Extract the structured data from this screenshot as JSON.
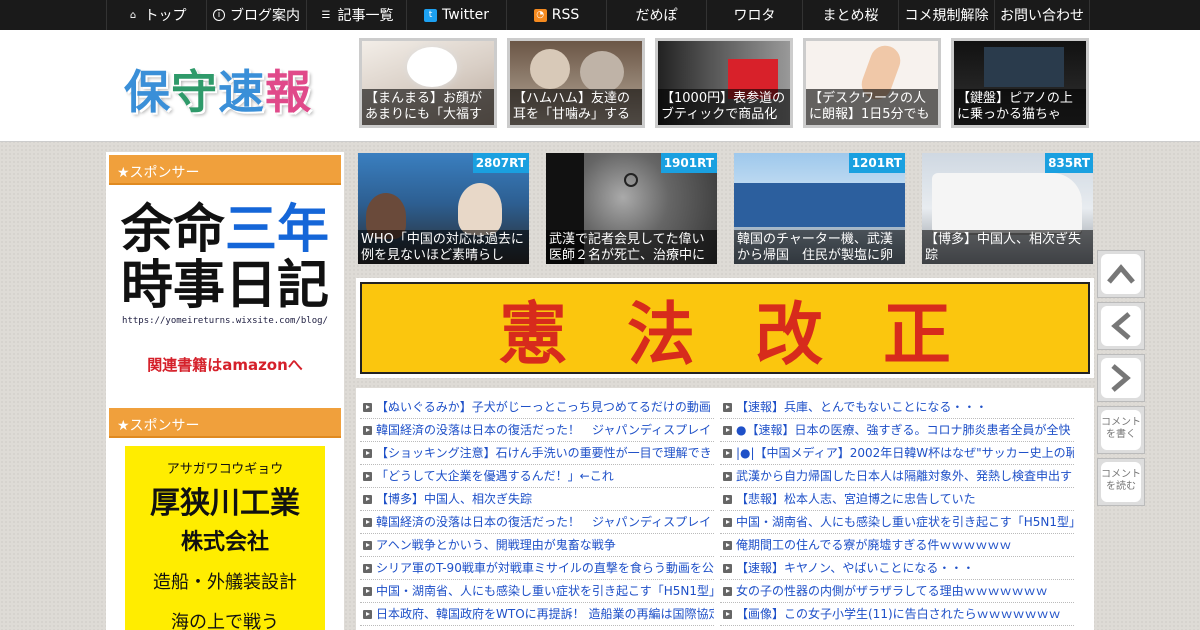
{
  "nav": [
    {
      "label": "トップ",
      "icon": "home-icon"
    },
    {
      "label": "ブログ案内",
      "icon": "info-icon"
    },
    {
      "label": "記事一覧",
      "icon": "list-icon"
    },
    {
      "label": "Twitter",
      "icon": "twitter-icon"
    },
    {
      "label": "RSS",
      "icon": "rss-icon"
    },
    {
      "label": "だめぽ"
    },
    {
      "label": "ワロタ"
    },
    {
      "label": "まとめ桜"
    },
    {
      "label": "コメ規制解除"
    },
    {
      "label": "お問い合わせ"
    }
  ],
  "logo": {
    "c1": "保",
    "c2": "守",
    "c3": "速",
    "c4": "報"
  },
  "header_thumbs": [
    {
      "caption": "【まんまる】お顔があまりにも「大福す"
    },
    {
      "caption": "【ハムハム】友達の耳を「甘噛み」する"
    },
    {
      "caption": "【1000円】表参道のブティックで商品化"
    },
    {
      "caption": "【デスクワークの人に朗報】1日5分でも"
    },
    {
      "caption": "【鍵盤】ピアノの上に乗っかる猫ちゃ"
    }
  ],
  "featured": [
    {
      "rt": "2807RT",
      "caption": "WHO「中国の対応は過去に例を見ないほど素晴らし"
    },
    {
      "rt": "1901RT",
      "caption": "武漢で記者会見してた偉い医師２名が死亡、治療中に"
    },
    {
      "rt": "1201RT",
      "caption": "韓国のチャーター機、武漢から帰国　住民が製塩に卵"
    },
    {
      "rt": "835RT",
      "caption": "【博多】中国人、相次ぎ失踪"
    }
  ],
  "sidebar": {
    "sponsor1": "★スポンサー",
    "ad1": {
      "line1a": "余命",
      "line1b": "三年",
      "line2": "時事日記",
      "url": "https://yomeireturns.wixsite.com/blog/",
      "link": "関連書籍はamazonへ"
    },
    "sponsor2": "★スポンサー",
    "ad2": {
      "kana": "アサガワコウギョウ",
      "name": "厚狭川工業",
      "corp": "株式会社",
      "desc": "造船・外艤装設計",
      "more": "海の上で戦う"
    }
  },
  "banner": {
    "c1": "憲",
    "c2": "法",
    "c3": "改",
    "c4": "正"
  },
  "list_left": [
    "【ぬいぐるみか】子犬がじーっとこっち見つめてるだけの動画",
    "韓国経済の没落は日本の復活だった！　ジャパンディスプレイ",
    "【ショッキング注意】石けん手洗いの重要性が一目で理解でき",
    "「どうして大企業を優遇するんだ！」←これ",
    "【博多】中国人、相次ぎ失踪",
    "韓国経済の没落は日本の復活だった！　ジャパンディスプレイ",
    "アヘン戦争とかいう、開戦理由が鬼畜な戦争",
    "シリア軍のT-90戦車が対戦車ミサイルの直撃を食らう動画を公",
    "中国・湖南省、人にも感染し重い症状を引き起こす「H5N1型」",
    "日本政府、韓国政府をWTOに再提訴！ 造船業の再編は国際協定"
  ],
  "list_right": [
    "【速報】兵庫、とんでもないことになる・・・",
    "●【速報】日本の医療、強すぎる。コロナ肺炎患者全員が全快",
    "|●|【中国メディア】2002年日韓W杯はなぜ\"サッカー史上の恥",
    "武漢から自力帰国した日本人は隔離対象外、発熱し検査申出す",
    "【悲報】松本人志、宮迫博之に忠告していた",
    "中国・湖南省、人にも感染し重い症状を引き起こす「H5N1型」",
    "俺期間工の住んでる寮が廃墟すぎる件ｗｗｗｗｗｗ",
    "【速報】キヤノン、やばいことになる・・・",
    "女の子の性器の内側がザラザラしてる理由ｗｗｗｗｗｗｗ",
    "【画像】この女子小学生(11)に告白されたらｗｗｗｗｗｗｗ"
  ],
  "side_buttons": {
    "comment_write": "コメントを書く",
    "comment_read": "コメントを読む"
  }
}
